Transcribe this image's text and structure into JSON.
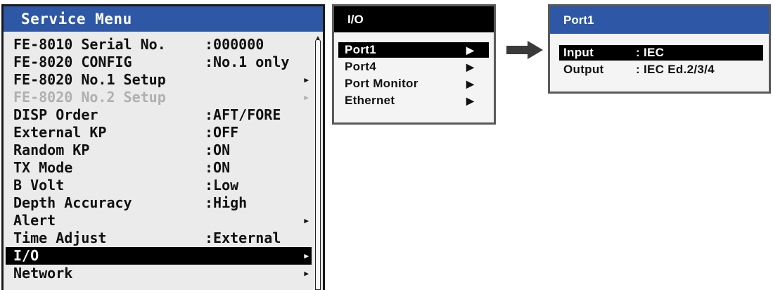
{
  "service_menu": {
    "title": "Service Menu",
    "items": [
      {
        "label": "FE-8010 Serial No.",
        "value": ":000000",
        "arrow": ""
      },
      {
        "label": "FE-8020 CONFIG",
        "value": ":No.1 only",
        "arrow": ""
      },
      {
        "label": "FE-8020 No.1 Setup",
        "value": "",
        "arrow": "▶"
      },
      {
        "label": "FE-8020 No.2 Setup",
        "value": "",
        "arrow": "▶"
      },
      {
        "label": "DISP Order",
        "value": ":AFT/FORE",
        "arrow": ""
      },
      {
        "label": "External KP",
        "value": ":OFF",
        "arrow": ""
      },
      {
        "label": "Random KP",
        "value": ":ON",
        "arrow": ""
      },
      {
        "label": "TX Mode",
        "value": ":ON",
        "arrow": ""
      },
      {
        "label": "B Volt",
        "value": ":Low",
        "arrow": ""
      },
      {
        "label": "Depth Accuracy",
        "value": ":High",
        "arrow": ""
      },
      {
        "label": "Alert",
        "value": "",
        "arrow": "▶"
      },
      {
        "label": "Time Adjust",
        "value": ":External",
        "arrow": ""
      },
      {
        "label": "I/O",
        "value": "",
        "arrow": "▶"
      },
      {
        "label": "Network",
        "value": "",
        "arrow": "▶"
      }
    ]
  },
  "io_menu": {
    "title": "I/O",
    "items": [
      {
        "label": "Port1",
        "arrow": "▶"
      },
      {
        "label": "Port4",
        "arrow": "▶"
      },
      {
        "label": "Port Monitor",
        "arrow": "▶"
      },
      {
        "label": "Ethernet",
        "arrow": "▶"
      }
    ]
  },
  "port1_menu": {
    "title": "Port1",
    "items": [
      {
        "label": "Input",
        "value": ": IEC"
      },
      {
        "label": "Output",
        "value": ": IEC Ed.2/3/4"
      }
    ]
  },
  "colors": {
    "title_bar_blue": "#2e57a6",
    "selection": "#000000",
    "disabled_text": "#b0b0b0",
    "arrow": "#3a3a3a"
  },
  "icons": {
    "submenu_arrow": "triangle-right-icon",
    "flow_arrow": "right-arrow-icon"
  }
}
